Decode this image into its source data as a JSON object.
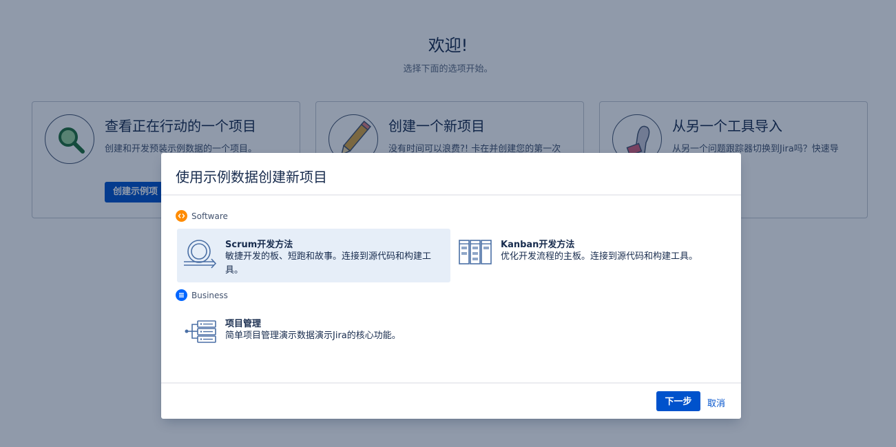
{
  "welcome": {
    "title": "欢迎!",
    "subtitle": "选择下面的选项开始。"
  },
  "cards": [
    {
      "title": "查看正在行动的一个项目",
      "desc": "创建和开发预装示例数据的一个项目。",
      "button": "创建示例项"
    },
    {
      "title": "创建一个新项目",
      "desc": "没有时间可以浪费?! 卡在并创建您的第一次"
    },
    {
      "title": "从另一个工具导入",
      "desc": "从另一个问题跟踪器切换到Jira吗？快速导"
    }
  ],
  "modal": {
    "title": "使用示例数据创建新项目",
    "groups": [
      {
        "label": "Software",
        "icon": "code-icon",
        "color": "#ff8b00",
        "options": [
          {
            "name": "Scrum开发方法",
            "desc": "敏捷开发的板、短跑和故事。连接到源代码和构建工具。",
            "selected": true
          },
          {
            "name": "Kanban开发方法",
            "desc": "优化开发流程的主板。连接到源代码和构建工具。",
            "selected": false
          }
        ]
      },
      {
        "label": "Business",
        "icon": "list-icon",
        "color": "#0065ff",
        "options": [
          {
            "name": "项目管理",
            "desc": "简单项目管理演示数据演示Jira的核心功能。",
            "selected": false
          }
        ]
      }
    ],
    "next_label": "下一步",
    "cancel_label": "取消"
  },
  "colors": {
    "primary": "#0052cc",
    "selected_bg": "#e6eef8",
    "overlay": "rgba(9, 30, 66, 0.45)"
  }
}
